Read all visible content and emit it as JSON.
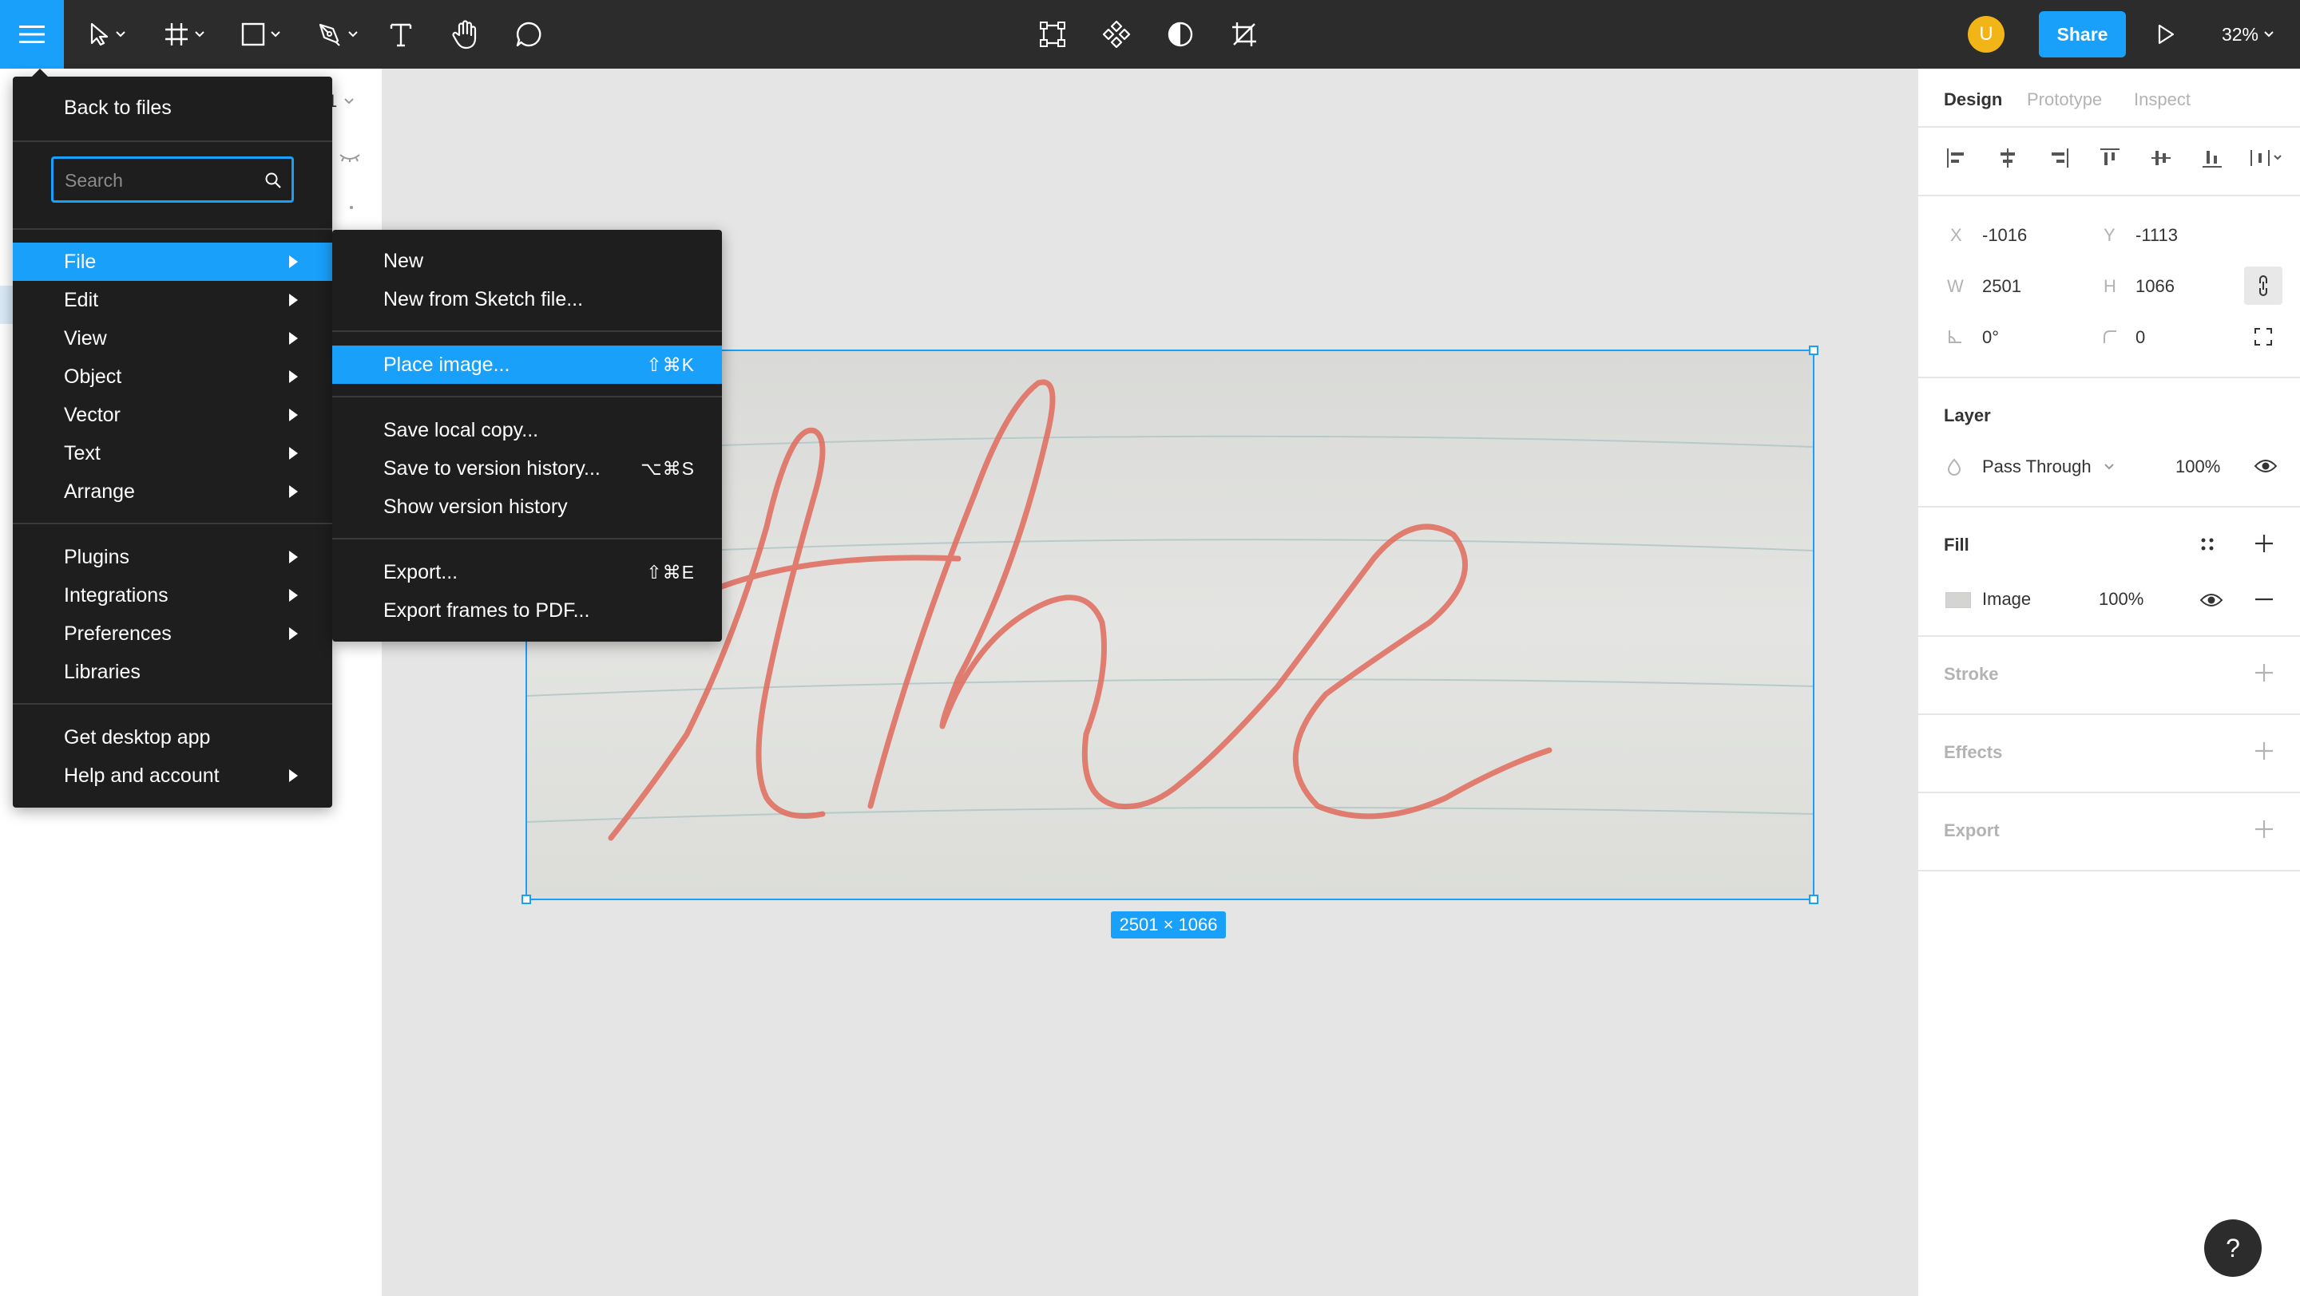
{
  "toolbar": {
    "zoom": "32%",
    "share_label": "Share",
    "avatar_initial": "U",
    "avatar_color": "#f2b518",
    "accent": "#18a0fb"
  },
  "main_menu": {
    "back_label": "Back to files",
    "search_placeholder": "Search",
    "items": [
      {
        "label": "File"
      },
      {
        "label": "Edit"
      },
      {
        "label": "View"
      },
      {
        "label": "Object"
      },
      {
        "label": "Vector"
      },
      {
        "label": "Text"
      },
      {
        "label": "Arrange"
      },
      {
        "label": "Plugins"
      },
      {
        "label": "Integrations"
      },
      {
        "label": "Preferences"
      },
      {
        "label": "Libraries"
      },
      {
        "label": "Get desktop app"
      },
      {
        "label": "Help and account"
      }
    ]
  },
  "file_submenu": {
    "items": [
      {
        "label": "New",
        "shortcut": ""
      },
      {
        "label": "New from Sketch file...",
        "shortcut": ""
      },
      {
        "label": "Place image...",
        "shortcut": "⇧⌘K"
      },
      {
        "label": "Save local copy...",
        "shortcut": ""
      },
      {
        "label": "Save to version history...",
        "shortcut": "⌥⌘S"
      },
      {
        "label": "Show version history",
        "shortcut": ""
      },
      {
        "label": "Export...",
        "shortcut": "⇧⌘E"
      },
      {
        "label": "Export frames to PDF...",
        "shortcut": ""
      }
    ]
  },
  "left_panel": {
    "partial_page_label": "1"
  },
  "canvas": {
    "image_text": "the",
    "ink_color": "#e06b5c",
    "size_badge": "2501 × 1066"
  },
  "design_panel": {
    "tabs": [
      "Design",
      "Prototype",
      "Inspect"
    ],
    "x_label": "X",
    "x_value": "-1016",
    "y_label": "Y",
    "y_value": "-1113",
    "w_label": "W",
    "w_value": "2501",
    "h_label": "H",
    "h_value": "1066",
    "rotation": "0°",
    "radius": "0",
    "layer_title": "Layer",
    "blend_mode": "Pass Through",
    "layer_opacity": "100%",
    "fill_title": "Fill",
    "fill_type": "Image",
    "fill_opacity": "100%",
    "stroke_title": "Stroke",
    "effects_title": "Effects",
    "export_title": "Export"
  },
  "help_label": "?"
}
